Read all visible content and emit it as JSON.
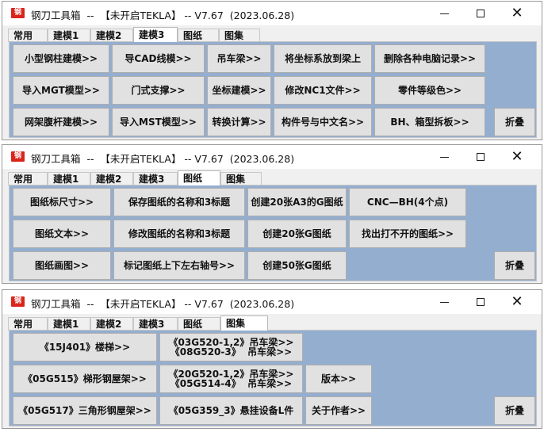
{
  "app": {
    "title": "钢刀工具箱  --  【未开启TEKLA】 -- V7.67  (2023.06.28)",
    "icon_label": "钢刀"
  },
  "tabs": [
    "常用",
    "建模1",
    "建模2",
    "建模3",
    "图纸",
    "图集"
  ],
  "window1": {
    "active_tab": "建模3",
    "buttons": {
      "b1": "小型钢柱建模>>",
      "b2": "导CAD线模>>",
      "b3": "吊车梁>>",
      "b4": "将坐标系放到梁上",
      "b5": "删除各种电脑记录>>",
      "b6": "导入MGT模型>>",
      "b7": "门式支撑>>",
      "b8": "坐标建模>>",
      "b9": "修改NC1文件>>",
      "b10": "零件等级色>>",
      "b11": "网架腹杆建模>>",
      "b12": "导入MST模型>>",
      "b13": "转换计算>>",
      "b14": "构件号与中文名>>",
      "b15": "BH、箱型拆板>>",
      "fold": "折叠"
    }
  },
  "window2": {
    "active_tab": "图纸",
    "buttons": {
      "b1": "图纸标尺寸>>",
      "b2": "保存图纸的名称和3标题",
      "b3": "创建20张A3的G图纸",
      "b4": "CNC—BH(4个点)",
      "b5": "图纸文本>>",
      "b6": "修改图纸的名称和3标题",
      "b7": "创建20张G图纸",
      "b8": "找出打不开的图纸>>",
      "b9": "图纸画图>>",
      "b10": "标记图纸上下左右轴号>>",
      "b11": "创建50张G图纸",
      "fold": "折叠"
    }
  },
  "window3": {
    "active_tab": "图集",
    "buttons": {
      "b1": "《15J401》楼梯>>",
      "b2_l1": "《03G520-1,2》吊车梁>>",
      "b2_l2": "《08G520-3》  吊车梁>>",
      "b3": "《05G515》梯形钢屋架>>",
      "b4_l1": "《20G520-1,2》吊车梁>>",
      "b4_l2": "《05G514-4》  吊车梁>>",
      "b5": "版本>>",
      "b6": "《05G517》三角形钢屋架>>",
      "b7": "《05G359_3》悬挂设备L件",
      "b8": "关于作者>>",
      "fold": "折叠"
    }
  }
}
